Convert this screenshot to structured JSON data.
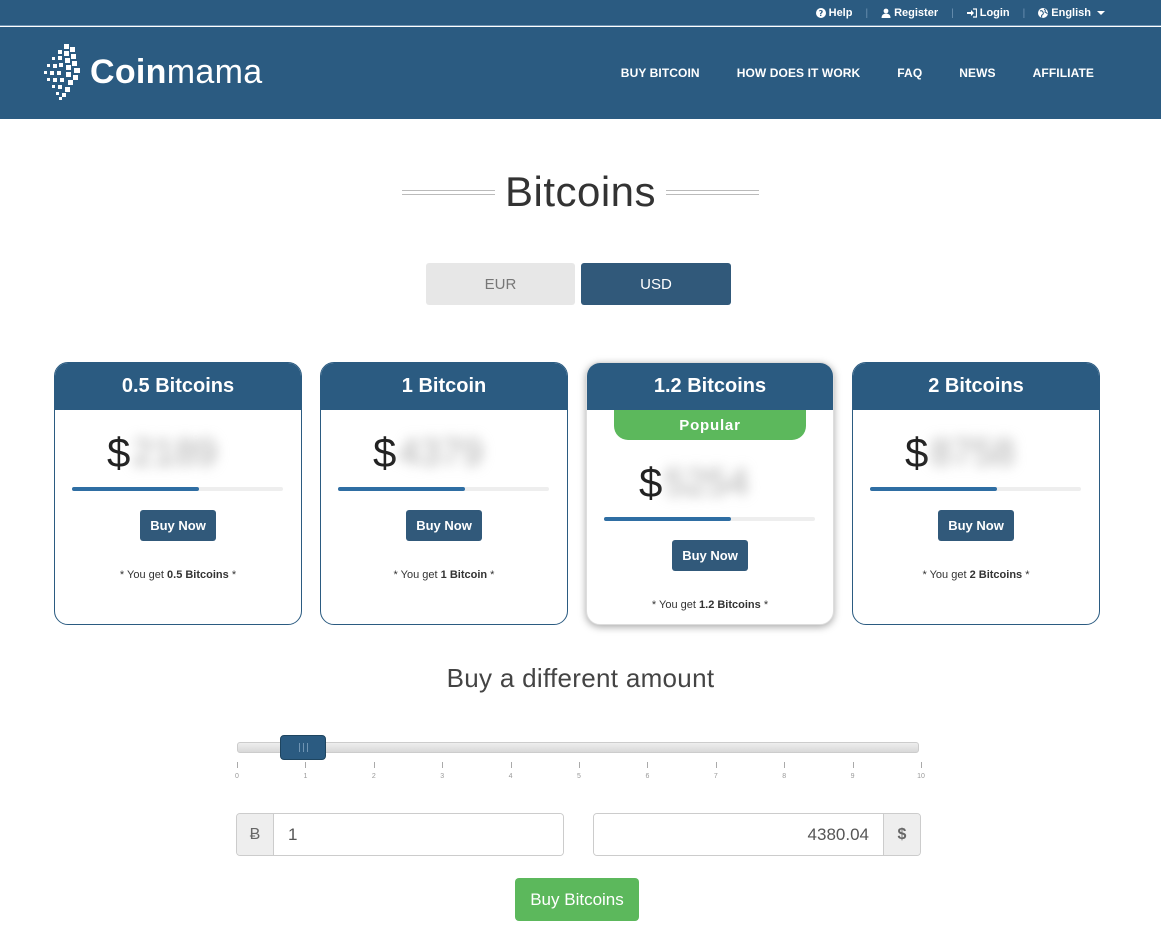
{
  "topbar": {
    "help": "Help",
    "register": "Register",
    "login": "Login",
    "language": "English",
    "separator": "|"
  },
  "brand": {
    "name_bold": "Coin",
    "name_light": "mama"
  },
  "nav": {
    "buy_bitcoin": "BUY BITCOIN",
    "how_it_works": "HOW DOES IT WORK",
    "faq": "FAQ",
    "news": "NEWS",
    "affiliate": "AFFILIATE"
  },
  "page_title": "Bitcoins",
  "currency": {
    "eur": "EUR",
    "usd": "USD",
    "selected": "USD"
  },
  "cards": [
    {
      "title": "0.5 Bitcoins",
      "currency_symbol": "$",
      "price": "2189",
      "bar_fill": 0.6,
      "button": "Buy Now",
      "you_get_prefix": "* You get",
      "you_get_amount": "0.5 Bitcoins",
      "you_get_suffix": "*"
    },
    {
      "title": "1 Bitcoin",
      "currency_symbol": "$",
      "price": "4379",
      "bar_fill": 0.6,
      "button": "Buy Now",
      "you_get_prefix": "* You get",
      "you_get_amount": "1 Bitcoin",
      "you_get_suffix": "*"
    },
    {
      "title": "1.2 Bitcoins",
      "badge": "Popular",
      "currency_symbol": "$",
      "price": "5254",
      "bar_fill": 0.6,
      "button": "Buy Now",
      "you_get_prefix": "* You get",
      "you_get_amount": "1.2 Bitcoins",
      "you_get_suffix": "*"
    },
    {
      "title": "2 Bitcoins",
      "currency_symbol": "$",
      "price": "8758",
      "bar_fill": 0.6,
      "button": "Buy Now",
      "you_get_prefix": "* You get",
      "you_get_amount": "2 Bitcoins",
      "you_get_suffix": "*"
    }
  ],
  "different_amount": {
    "title": "Buy a different amount",
    "slider": {
      "min": 0,
      "max": 10,
      "value": 1,
      "ticks": [
        "0",
        "1",
        "2",
        "3",
        "4",
        "5",
        "6",
        "7",
        "8",
        "9",
        "10"
      ]
    },
    "btc_symbol": "Ƀ",
    "btc_value": "1",
    "usd_value": "4380.04",
    "usd_symbol": "$",
    "button": "Buy Bitcoins"
  },
  "colors": {
    "brand": "#2b5b81",
    "button": "#31597a",
    "green": "#5cb85c"
  },
  "icons": {
    "help": "question-circle-icon",
    "register": "user-icon",
    "login": "sign-in-icon",
    "language": "globe-icon"
  }
}
